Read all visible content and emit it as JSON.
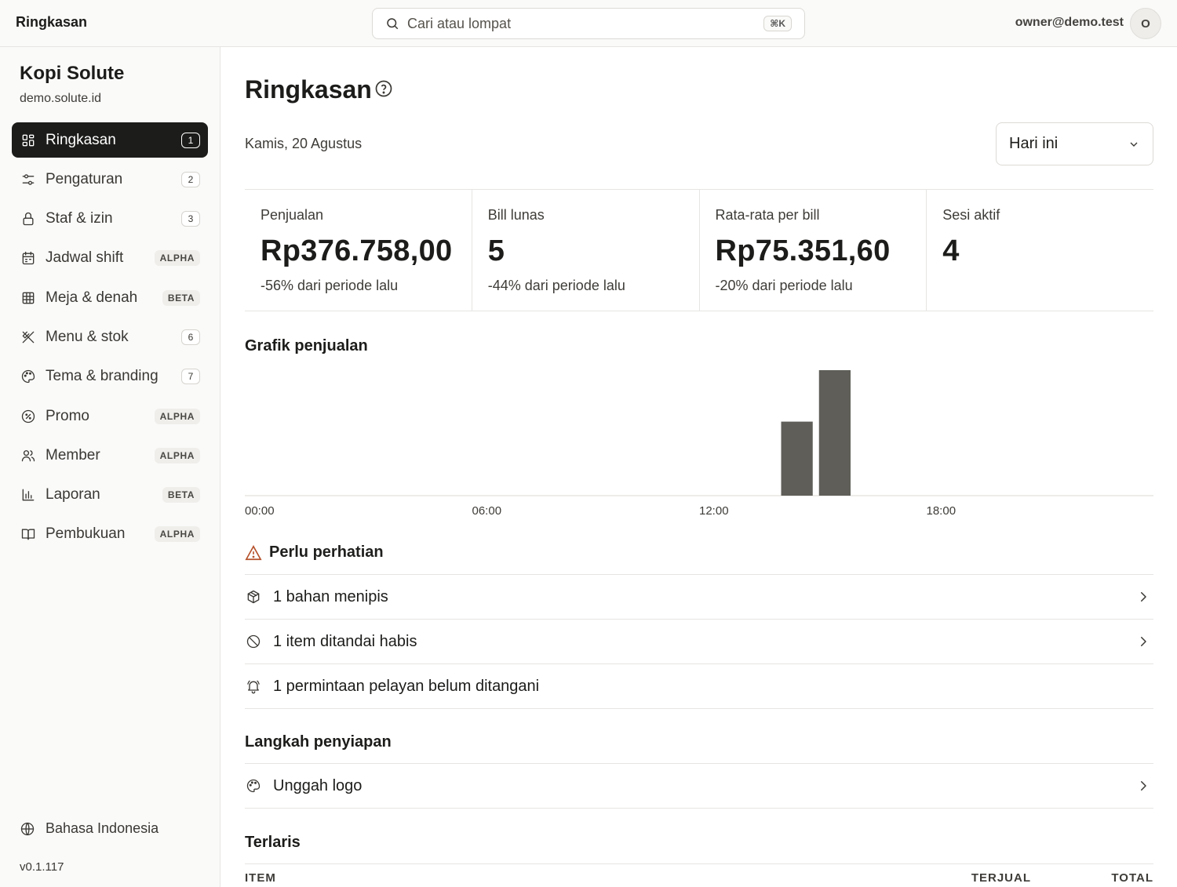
{
  "topbar": {
    "app_title": "Ringkasan",
    "search_placeholder": "Cari atau lompat",
    "shortcut": "⌘K",
    "user_email": "owner@demo.test",
    "avatar_initial": "O"
  },
  "sidebar": {
    "org_name": "Kopi Solute",
    "org_domain": "demo.solute.id",
    "items": [
      {
        "label": "Ringkasan",
        "badge": "1",
        "badge_type": "num",
        "icon": "dashboard-icon",
        "active": true
      },
      {
        "label": "Pengaturan",
        "badge": "2",
        "badge_type": "num",
        "icon": "settings-icon"
      },
      {
        "label": "Staf & izin",
        "badge": "3",
        "badge_type": "num",
        "icon": "lock-icon"
      },
      {
        "label": "Jadwal shift",
        "badge": "ALPHA",
        "badge_type": "tag",
        "icon": "calendar-icon"
      },
      {
        "label": "Meja & denah",
        "badge": "BETA",
        "badge_type": "tag",
        "icon": "grid-icon"
      },
      {
        "label": "Menu & stok",
        "badge": "6",
        "badge_type": "num",
        "icon": "utensils-icon"
      },
      {
        "label": "Tema & branding",
        "badge": "7",
        "badge_type": "num",
        "icon": "palette-icon"
      },
      {
        "label": "Promo",
        "badge": "ALPHA",
        "badge_type": "tag",
        "icon": "discount-icon"
      },
      {
        "label": "Member",
        "badge": "ALPHA",
        "badge_type": "tag",
        "icon": "users-icon"
      },
      {
        "label": "Laporan",
        "badge": "BETA",
        "badge_type": "tag",
        "icon": "bar-chart-icon"
      },
      {
        "label": "Pembukuan",
        "badge": "ALPHA",
        "badge_type": "tag",
        "icon": "book-icon"
      }
    ],
    "language": "Bahasa Indonesia",
    "version": "v0.1.117"
  },
  "main": {
    "title": "Ringkasan",
    "date": "Kamis, 20 Agustus",
    "period_selected": "Hari ini",
    "stats": [
      {
        "label": "Penjualan",
        "value": "Rp376.758,00",
        "delta": "-56% dari periode lalu"
      },
      {
        "label": "Bill lunas",
        "value": "5",
        "delta": "-44% dari periode lalu"
      },
      {
        "label": "Rata-rata per bill",
        "value": "Rp75.351,60",
        "delta": "-20% dari periode lalu"
      },
      {
        "label": "Sesi aktif",
        "value": "4",
        "delta": ""
      }
    ],
    "chart_title": "Grafik penjualan",
    "attention_title": "Perlu perhatian",
    "attention_items": [
      {
        "label": "1 bahan menipis",
        "icon": "package-icon",
        "has_chevron": true
      },
      {
        "label": "1 item ditandai habis",
        "icon": "ban-icon",
        "has_chevron": true
      },
      {
        "label": "1 permintaan pelayan belum ditangani",
        "icon": "bell-ring-icon",
        "has_chevron": false
      }
    ],
    "setup_title": "Langkah penyiapan",
    "setup_items": [
      {
        "label": "Unggah logo",
        "icon": "palette-icon",
        "has_chevron": true
      }
    ],
    "top_title": "Terlaris",
    "top_columns": [
      "ITEM",
      "TERJUAL",
      "TOTAL"
    ]
  },
  "chart_data": {
    "type": "bar",
    "x_labels": [
      "00:00",
      "06:00",
      "12:00",
      "18:00"
    ],
    "hours": [
      14,
      15
    ],
    "values": [
      0.59,
      1.0
    ],
    "bar_color": "#5f5e58",
    "note_values": "relative heights (fraction of tallest bar)"
  }
}
